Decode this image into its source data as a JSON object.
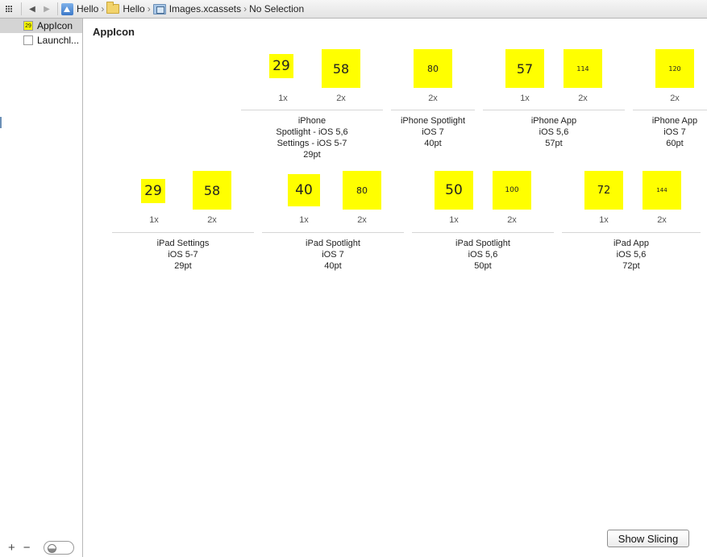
{
  "jumpbar": {
    "crumbs": [
      "Hello",
      "Hello",
      "Images.xcassets",
      "No Selection"
    ]
  },
  "sidebar": {
    "items": [
      {
        "label": "AppIcon",
        "thumb": "29",
        "selected": true
      },
      {
        "label": "Launchl...",
        "thumb": "",
        "selected": false
      }
    ]
  },
  "main": {
    "title": "AppIcon",
    "groups": [
      {
        "lines": [
          "iPhone",
          "Spotlight - iOS 5,6",
          "Settings - iOS 5-7",
          "29pt"
        ],
        "slots": [
          {
            "text": "29",
            "scale": "1x"
          },
          {
            "text": "58",
            "scale": "2x"
          }
        ]
      },
      {
        "lines": [
          "iPhone Spotlight",
          "iOS 7",
          "40pt"
        ],
        "slots": [
          {
            "text": "80",
            "scale": "2x"
          }
        ]
      },
      {
        "lines": [
          "iPhone App",
          "iOS 5,6",
          "57pt"
        ],
        "slots": [
          {
            "text": "57",
            "scale": "1x"
          },
          {
            "text": "114",
            "scale": "2x"
          }
        ]
      },
      {
        "lines": [
          "iPhone App",
          "iOS 7",
          "60pt"
        ],
        "slots": [
          {
            "text": "120",
            "scale": "2x"
          }
        ]
      },
      {
        "lines": [
          "iPad Settings",
          "iOS 5-7",
          "29pt"
        ],
        "slots": [
          {
            "text": "29",
            "scale": "1x"
          },
          {
            "text": "58",
            "scale": "2x"
          }
        ]
      },
      {
        "lines": [
          "iPad Spotlight",
          "iOS 7",
          "40pt"
        ],
        "slots": [
          {
            "text": "40",
            "scale": "1x"
          },
          {
            "text": "80",
            "scale": "2x"
          }
        ]
      },
      {
        "lines": [
          "iPad Spotlight",
          "iOS 5,6",
          "50pt"
        ],
        "slots": [
          {
            "text": "50",
            "scale": "1x"
          },
          {
            "text": "100",
            "scale": "2x"
          }
        ]
      },
      {
        "lines": [
          "iPad App",
          "iOS 5,6",
          "72pt"
        ],
        "slots": [
          {
            "text": "72",
            "scale": "1x"
          },
          {
            "text": "144",
            "scale": "2x"
          }
        ]
      }
    ],
    "show_slicing_label": "Show Slicing"
  },
  "colors": {
    "icon_fill": "#ffff00",
    "selection": "#d4d4d4"
  }
}
